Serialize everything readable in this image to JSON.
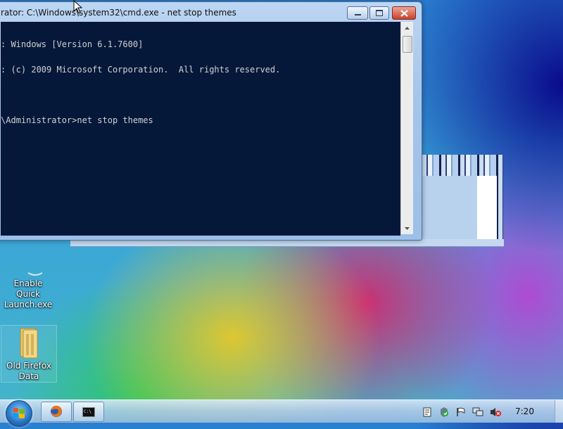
{
  "window": {
    "title": "rator: C:\\Windows\\system32\\cmd.exe - net  stop themes",
    "minimize_glyph": "–",
    "maximize_glyph": "▢",
    "close_glyph": "✕"
  },
  "console": {
    "lines": [
      ": Windows [Version 6.1.7600]",
      ": (c) 2009 Microsoft Corporation.  All rights reserved.",
      "",
      "\\Administrator>net stop themes"
    ]
  },
  "desktop": {
    "icons": [
      {
        "label_line1": "Enable Quick",
        "label_line2": "Launch.exe",
        "icon": "executable-icon"
      },
      {
        "label_line1": "Old Firefox",
        "label_line2": "Data",
        "icon": "folder-icon"
      }
    ]
  },
  "taskbar": {
    "clock": "7:20",
    "pinned": [
      {
        "icon": "firefox-icon"
      },
      {
        "icon": "cmd-icon",
        "label": "C:\\"
      }
    ],
    "tray": [
      "document-icon",
      "security-shield-icon",
      "action-center-flag-icon",
      "network-icon",
      "volume-muted-icon"
    ]
  },
  "colors": {
    "console_bg": "#06183a",
    "console_fg": "#d0d0d0",
    "close_red": "#c9412a"
  }
}
